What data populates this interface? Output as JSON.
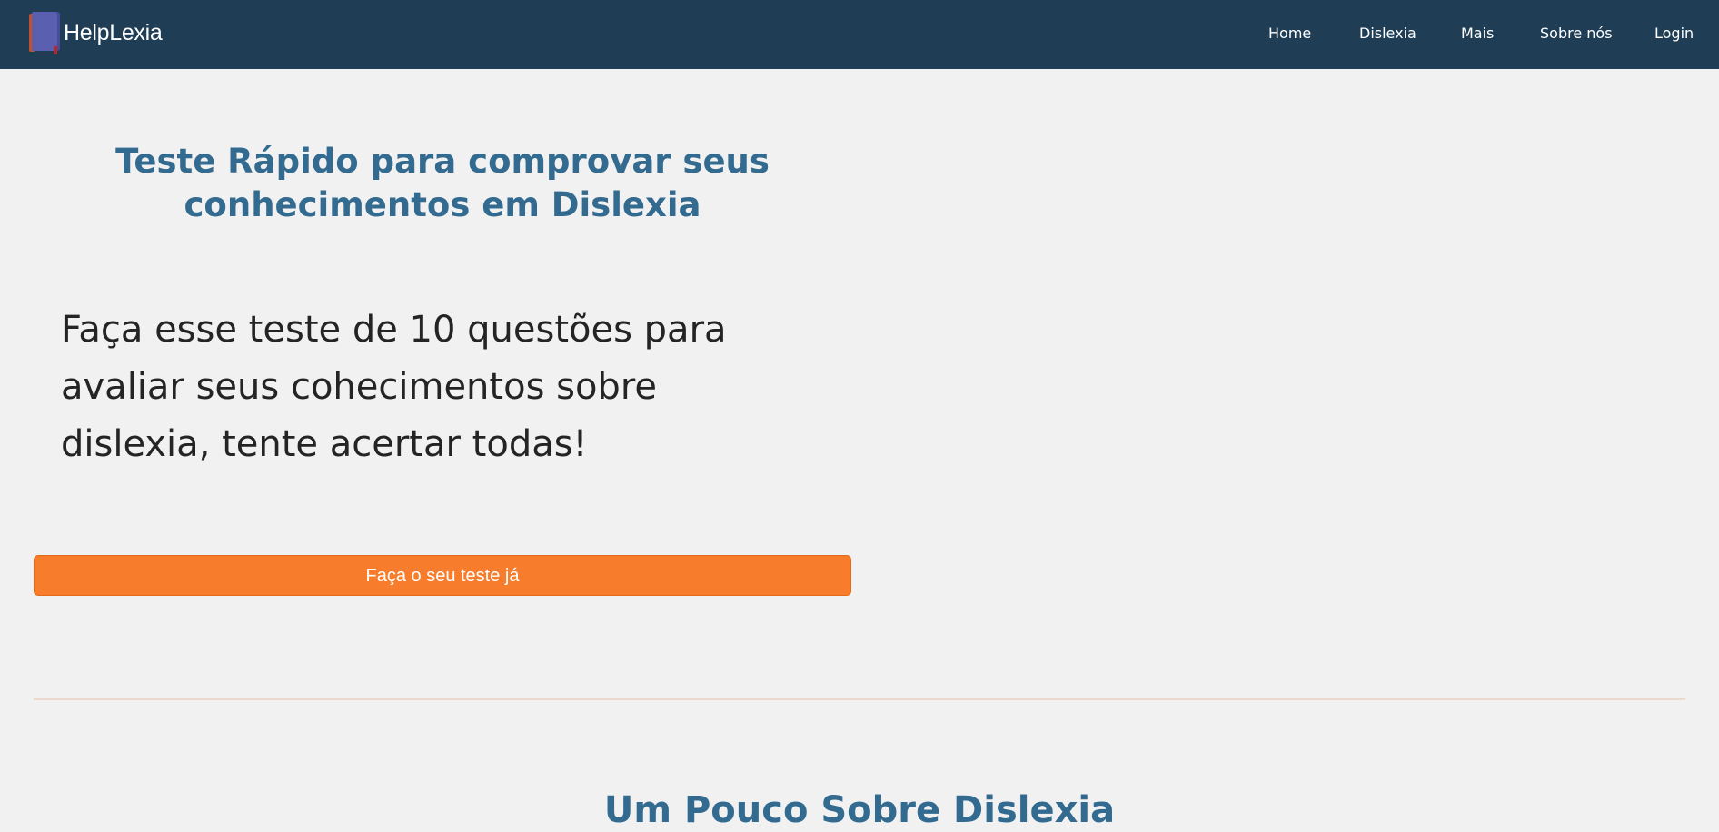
{
  "brand": {
    "name": "HelpLexia",
    "icon": "book-icon"
  },
  "nav": {
    "items": [
      {
        "label": "Home"
      },
      {
        "label": "Dislexia"
      },
      {
        "label": "Mais"
      },
      {
        "label": "Sobre nós"
      },
      {
        "label": "Login"
      }
    ]
  },
  "hero": {
    "title_line1": "Teste Rápido para comprovar seus",
    "title_line2": "conhecimentos em Dislexia",
    "text_line1": "Faça esse teste de 10 questões para",
    "text_line2": "avaliar seus cohecimentos sobre",
    "text_line3": "dislexia, tente acertar todas!",
    "cta_label": "Faça o seu teste já"
  },
  "section": {
    "title": "Um Pouco Sobre Dislexia"
  },
  "colors": {
    "navbar": "#1f3d54",
    "heading": "#336b90",
    "cta": "#f77c2b",
    "background": "#f2f1f1",
    "divider": "#ecd9cb"
  }
}
